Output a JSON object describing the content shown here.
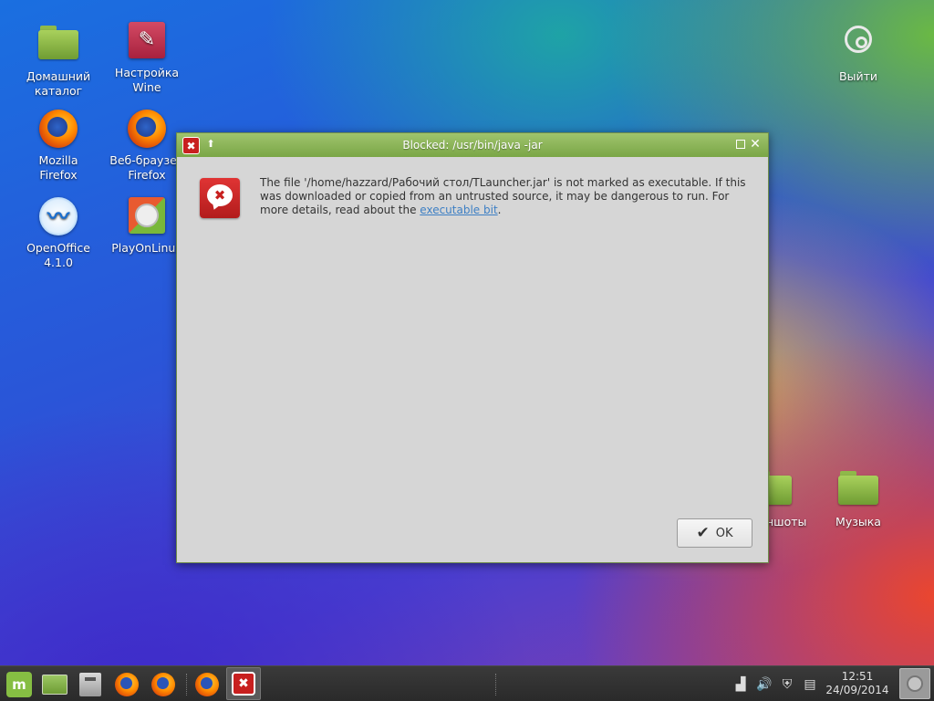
{
  "desktop": {
    "icons": [
      {
        "label": "Домашний\nкаталог"
      },
      {
        "label": "Настройка\nWine"
      },
      {
        "label": "Mozilla\nFirefox"
      },
      {
        "label": "Веб-браузер\nFirefox"
      },
      {
        "label": "OpenOffice\n4.1.0"
      },
      {
        "label": "PlayOnLinux"
      },
      {
        "label": "Выйти"
      },
      {
        "label": "Скриншоты"
      },
      {
        "label": "Музыка"
      }
    ]
  },
  "dialog": {
    "title": "Blocked: /usr/bin/java -jar",
    "message_before_link": "The file '/home/hazzard/Рабочий стол/TLauncher.jar' is not marked as executable.  If this was downloaded or copied from an untrusted source, it may be dangerous to run.  For more details, read about the ",
    "link_text": "executable bit",
    "message_after_link": ".",
    "ok_label": "OK"
  },
  "panel": {
    "clock_time": "12:51",
    "clock_date": "24/09/2014"
  },
  "colors": {
    "titlebar": "#7aa646",
    "error_red": "#c8201f",
    "link": "#3d7fc4"
  }
}
